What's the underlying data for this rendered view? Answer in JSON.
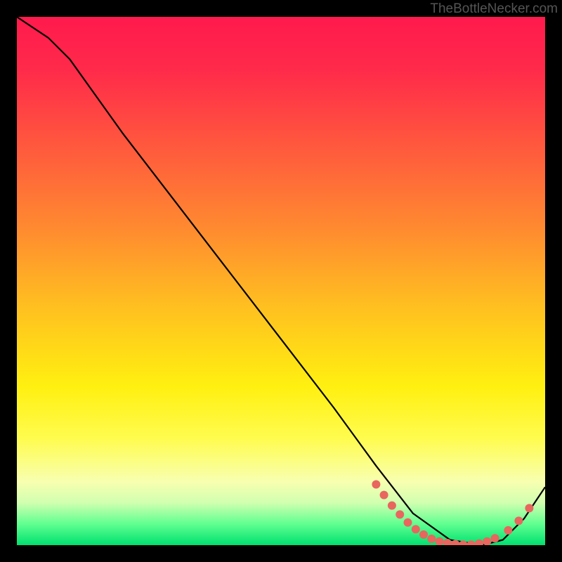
{
  "watermark": "TheBottleNecker.com",
  "chart_data": {
    "type": "line",
    "title": "",
    "xlabel": "",
    "ylabel": "",
    "xlim": [
      0,
      100
    ],
    "ylim": [
      0,
      100
    ],
    "series": [
      {
        "name": "bottleneck-curve",
        "x": [
          0,
          6,
          10,
          20,
          30,
          40,
          50,
          60,
          68,
          75,
          82,
          88,
          92,
          96,
          100
        ],
        "y": [
          100,
          96,
          92,
          78,
          65,
          52,
          39,
          26,
          15,
          6,
          1,
          0,
          1,
          5,
          11
        ]
      }
    ],
    "markers": {
      "name": "highlight-dots",
      "points": [
        {
          "x": 68.0,
          "y": 11.5
        },
        {
          "x": 69.5,
          "y": 9.5
        },
        {
          "x": 71.0,
          "y": 7.5
        },
        {
          "x": 72.5,
          "y": 5.8
        },
        {
          "x": 74.0,
          "y": 4.3
        },
        {
          "x": 75.5,
          "y": 3.0
        },
        {
          "x": 77.0,
          "y": 2.0
        },
        {
          "x": 78.5,
          "y": 1.2
        },
        {
          "x": 80.0,
          "y": 0.7
        },
        {
          "x": 81.5,
          "y": 0.4
        },
        {
          "x": 83.0,
          "y": 0.2
        },
        {
          "x": 84.5,
          "y": 0.1
        },
        {
          "x": 86.0,
          "y": 0.1
        },
        {
          "x": 87.5,
          "y": 0.3
        },
        {
          "x": 89.0,
          "y": 0.7
        },
        {
          "x": 90.5,
          "y": 1.3
        },
        {
          "x": 93.0,
          "y": 2.8
        },
        {
          "x": 95.0,
          "y": 4.6
        },
        {
          "x": 97.0,
          "y": 7.0
        }
      ]
    },
    "colors": {
      "curve": "#000000",
      "markers": "#e8665e"
    }
  }
}
